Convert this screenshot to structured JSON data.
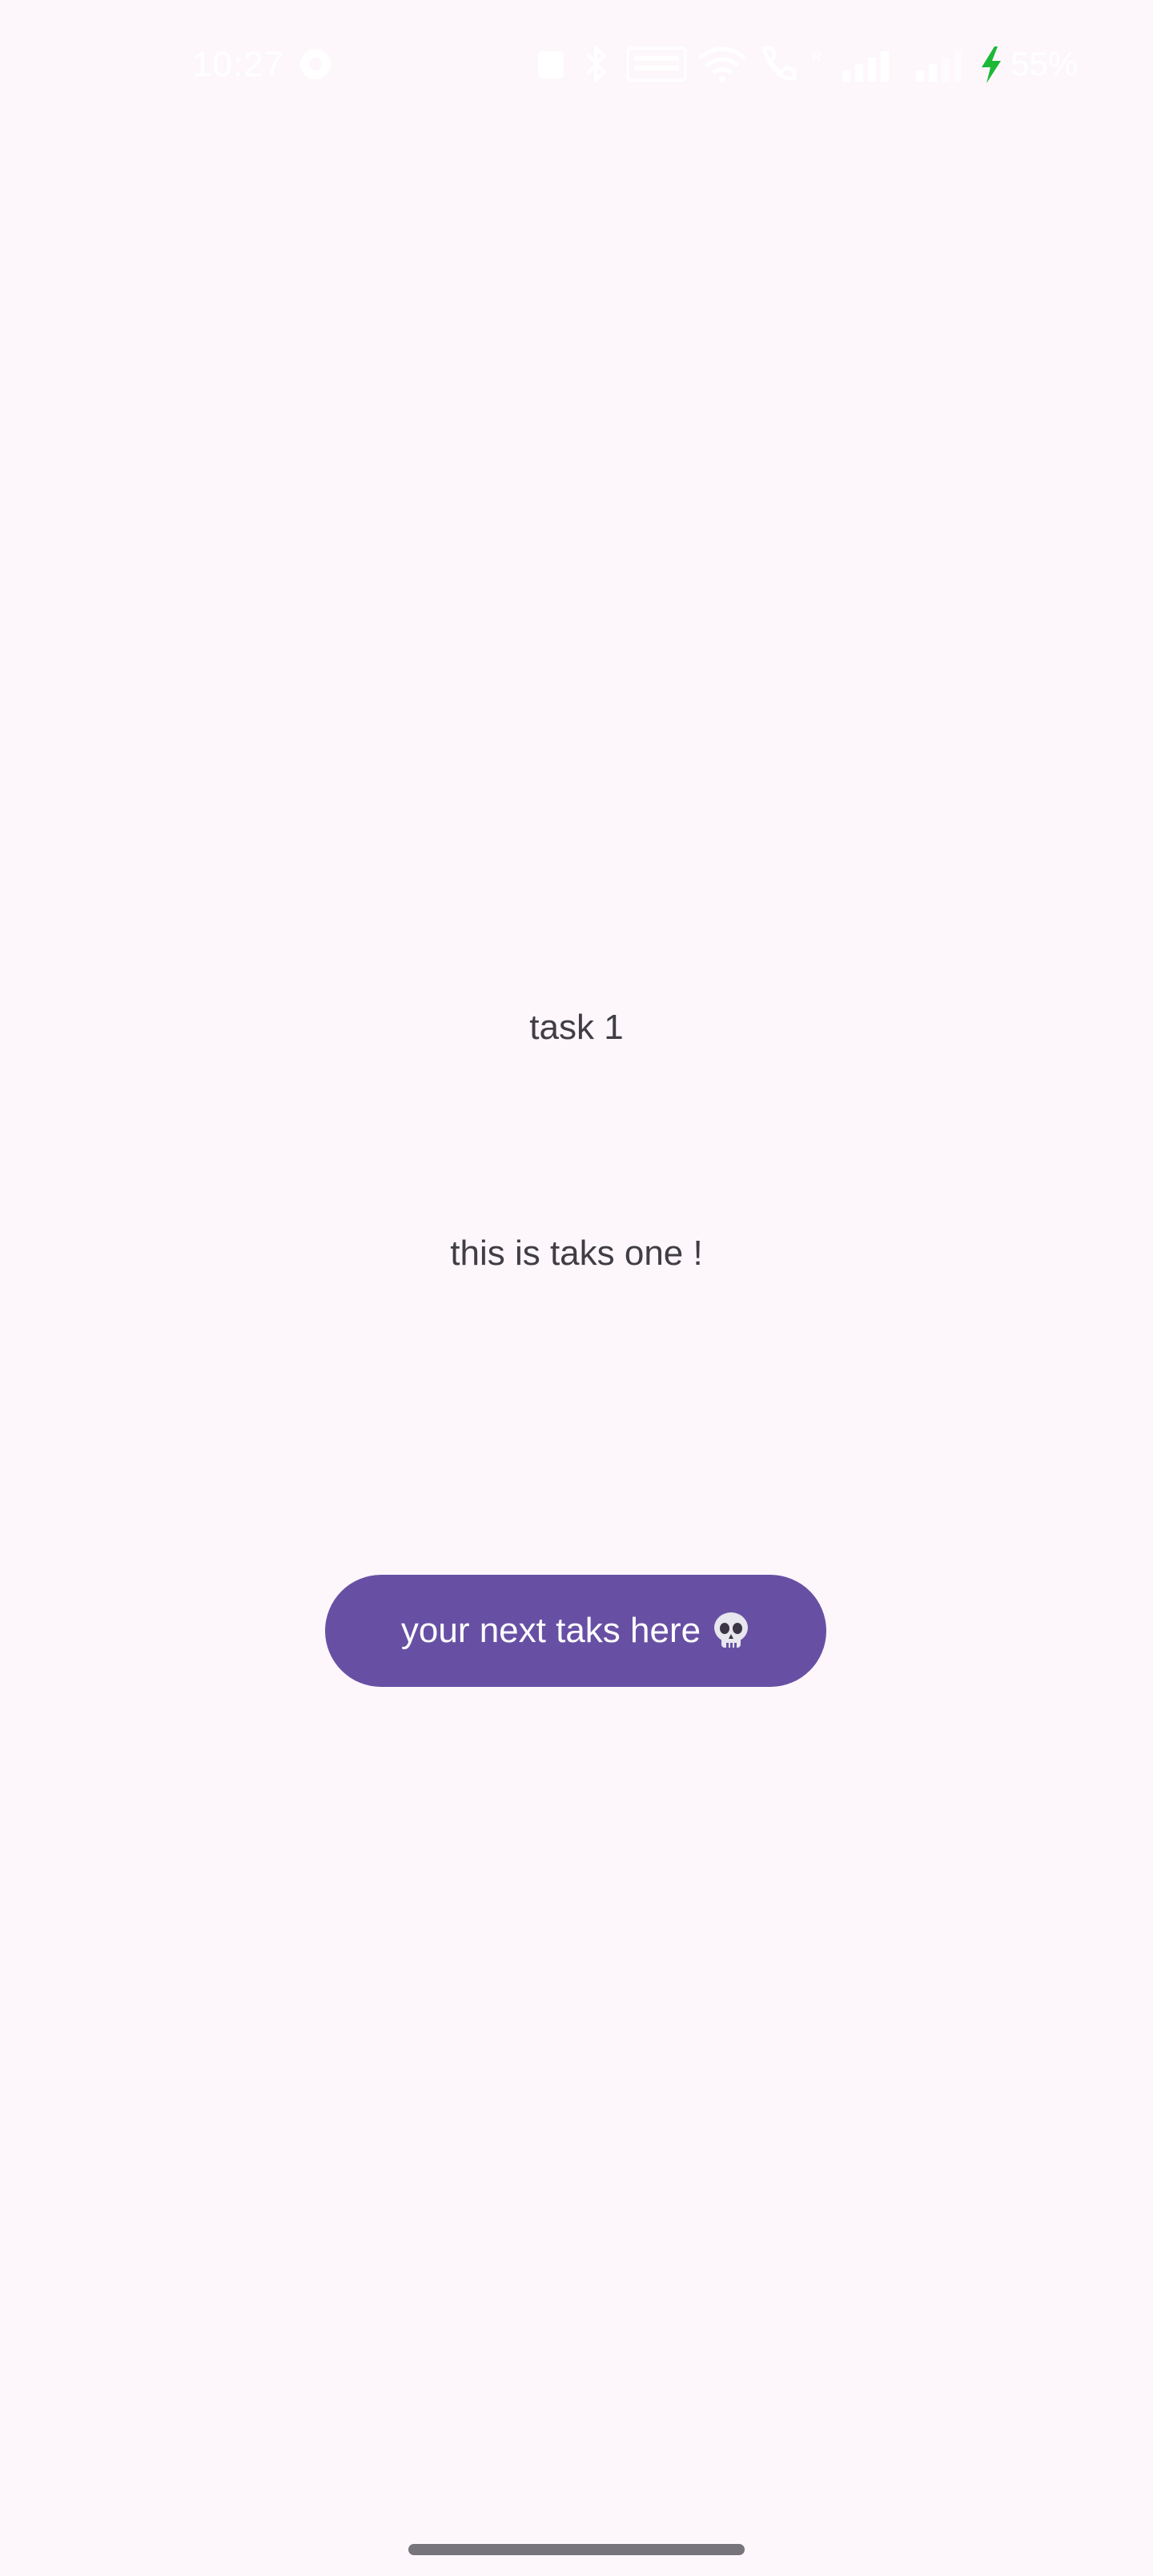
{
  "status_bar": {
    "time": "10:27",
    "battery_percent": "55%",
    "battery_charging": true,
    "icons": [
      "notification-icon",
      "alarm-icon",
      "bluetooth-icon",
      "volte-icon",
      "wifi-icon",
      "call-icon",
      "signal-icon",
      "signal-icon",
      "battery-charging-icon"
    ],
    "charging_color": "#1db835"
  },
  "task": {
    "title": "task 1",
    "description": "this is taks one !"
  },
  "next_button": {
    "label": "your next taks here",
    "icon": "skull-icon",
    "background": "#6750a4"
  },
  "theme": {
    "background": "#fdf7fc",
    "text": "#403d45",
    "gesture_bar": "#77747c"
  }
}
